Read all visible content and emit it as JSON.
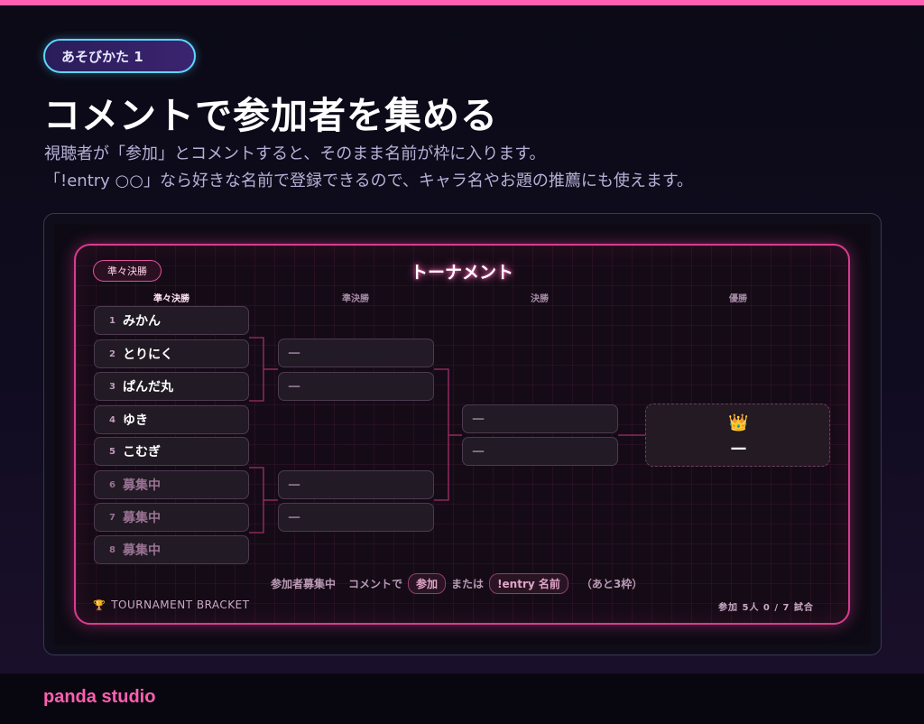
{
  "header": {
    "pill_label": "あそびかた 1",
    "title": "コメントで参加者を集める",
    "desc_line1": "視聴者が「参加」とコメントすると、そのまま名前が枠に入ります。",
    "desc_line2": "「!entry ○○」なら好きな名前で登録できるので、キャラ名やお題の推薦にも使えます。"
  },
  "board": {
    "badge": "準々決勝",
    "title": "トーナメント",
    "columns": [
      "準々決勝",
      "準決勝",
      "決勝",
      "優勝"
    ],
    "quarter": [
      {
        "num": "1",
        "name": "みかん"
      },
      {
        "num": "2",
        "name": "とりにく"
      },
      {
        "num": "3",
        "name": "ぱんだ丸"
      },
      {
        "num": "4",
        "name": "ゆき"
      },
      {
        "num": "5",
        "name": "こむぎ"
      },
      {
        "num": "6",
        "name": "募集中"
      },
      {
        "num": "7",
        "name": "募集中"
      },
      {
        "num": "8",
        "name": "募集中"
      }
    ],
    "semi": [
      "—",
      "—",
      "—",
      "—"
    ],
    "final": [
      "—",
      "—"
    ],
    "champion": {
      "crown_icon": "👑",
      "name": "—"
    },
    "footer": {
      "status": "参加者募集中",
      "comment_prefix": "コメントで",
      "chip1": "参加",
      "or_text": "または",
      "chip2": "!entry 名前",
      "remaining": "（あと3枠）"
    },
    "bottom_left_icon": "🏆",
    "bottom_left": "TOURNAMENT BRACKET",
    "bottom_right": "参加 5人 0 / 7 試合"
  },
  "brand": "panda studio",
  "colors": {
    "accent": "#ff5fb0",
    "cyan": "#5fd6ff",
    "board_border": "#d83c8f"
  }
}
